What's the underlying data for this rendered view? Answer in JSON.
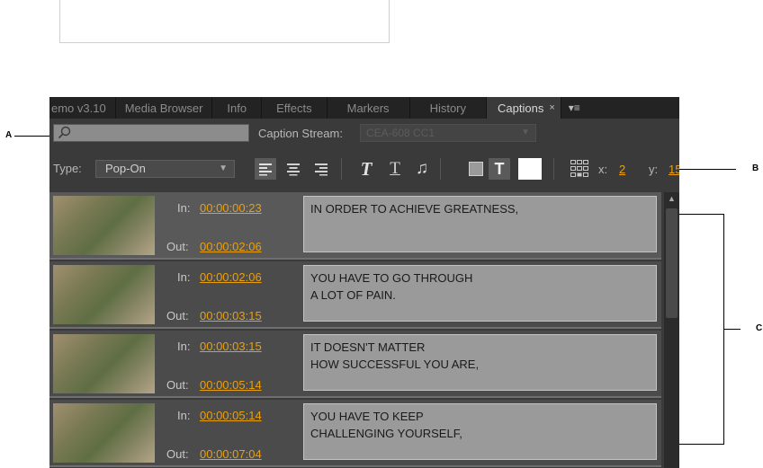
{
  "callouts": {
    "a": "A",
    "b": "B",
    "c": "C"
  },
  "tabs": [
    {
      "label": "emo v3.10"
    },
    {
      "label": "Media Browser"
    },
    {
      "label": "Info"
    },
    {
      "label": "Effects"
    },
    {
      "label": "Markers"
    },
    {
      "label": "History"
    }
  ],
  "active_tab": {
    "label": "Captions",
    "close": "×"
  },
  "panel_menu": "▾≡",
  "search": {
    "value": ""
  },
  "caption_stream": {
    "label": "Caption Stream:",
    "value": "CEA-608 CC1"
  },
  "type_select": {
    "label": "Type:",
    "value": "Pop-On"
  },
  "position": {
    "x_label": "x:",
    "x_value": "2",
    "y_label": "y:",
    "y_value": "15"
  },
  "captions": [
    {
      "in_label": "In:",
      "in": "00:00:00:23",
      "out_label": "Out:",
      "out": "00:00:02:06",
      "text": "IN ORDER TO ACHIEVE GREATNESS,"
    },
    {
      "in_label": "In:",
      "in": "00:00:02:06",
      "out_label": "Out:",
      "out": "00:00:03:15",
      "text": "YOU HAVE TO GO THROUGH\nA LOT OF PAIN."
    },
    {
      "in_label": "In:",
      "in": "00:00:03:15",
      "out_label": "Out:",
      "out": "00:00:05:14",
      "text": "IT DOESN'T MATTER\nHOW SUCCESSFUL YOU ARE,"
    },
    {
      "in_label": "In:",
      "in": "00:00:05:14",
      "out_label": "Out:",
      "out": "00:00:07:04",
      "text": "YOU HAVE TO KEEP\nCHALLENGING YOURSELF,"
    }
  ],
  "colors": {
    "timecode": "#e8a010",
    "panel_bg": "#3a3a3a",
    "caption_box": "#9a9a9a"
  }
}
